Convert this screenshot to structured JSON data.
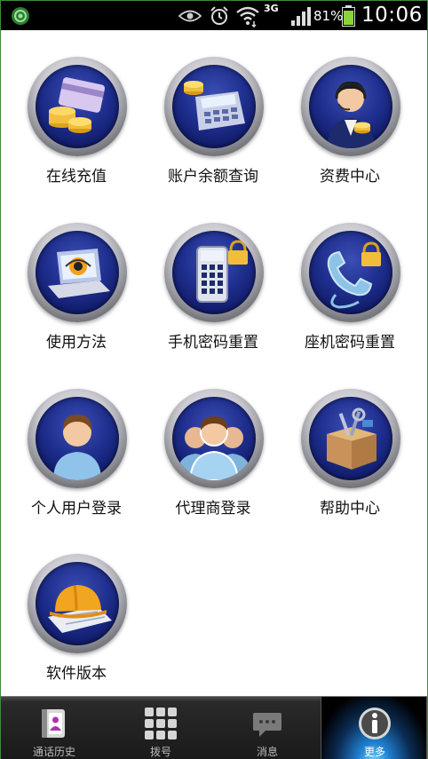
{
  "status_bar": {
    "network": "3G",
    "battery_percent": "81%",
    "time": "10:06",
    "icons": [
      "app-icon",
      "eye-icon",
      "alarm-icon",
      "wifi-icon",
      "signal-icon",
      "battery-icon"
    ]
  },
  "tiles": [
    {
      "label": "在线充值",
      "icon": "recharge-card-coins-icon"
    },
    {
      "label": "账户余额查询",
      "icon": "calculator-coins-icon"
    },
    {
      "label": "资费中心",
      "icon": "agent-headset-icon"
    },
    {
      "label": "使用方法",
      "icon": "laptop-eye-icon"
    },
    {
      "label": "手机密码重置",
      "icon": "phone-keypad-lock-icon"
    },
    {
      "label": "座机密码重置",
      "icon": "telephone-handset-lock-icon"
    },
    {
      "label": "个人用户登录",
      "icon": "single-user-icon"
    },
    {
      "label": "代理商登录",
      "icon": "user-group-icon"
    },
    {
      "label": "帮助中心",
      "icon": "toolbox-icon"
    },
    {
      "label": "软件版本",
      "icon": "hardhat-blueprint-icon"
    }
  ],
  "tabbar": {
    "tabs": [
      {
        "label": "通话历史",
        "icon": "call-history-icon",
        "active": false
      },
      {
        "label": "拨号",
        "icon": "dialpad-icon",
        "active": false
      },
      {
        "label": "消息",
        "icon": "message-icon",
        "active": false
      },
      {
        "label": "更多",
        "icon": "info-icon",
        "active": true
      }
    ]
  },
  "colors": {
    "status_bar_bg": "#000000",
    "tile_inner_blue": "#1f2f8f",
    "active_tab_glow": "#6fd7ff",
    "battery_green": "#8bd33a"
  }
}
